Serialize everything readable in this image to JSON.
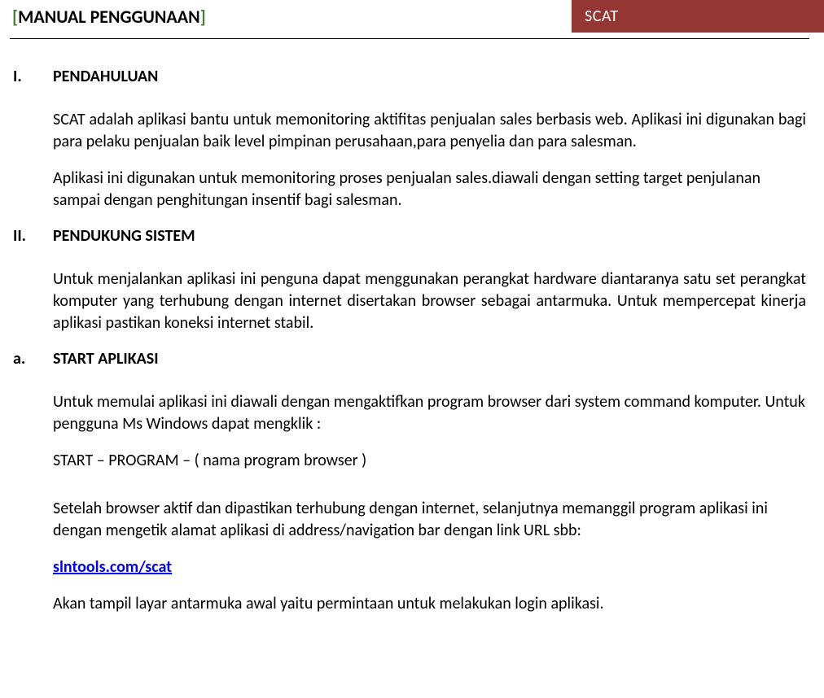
{
  "header": {
    "bracket_left": "[",
    "title": "MANUAL PENGGUNAAN",
    "bracket_right": "]",
    "badge": "SCAT"
  },
  "sections": {
    "s1": {
      "num": "I.",
      "heading": "PENDAHULUAN"
    },
    "s2": {
      "num": "II.",
      "heading": "PENDUKUNG SISTEM"
    },
    "s3": {
      "num": "a.",
      "heading": "START APLIKASI"
    }
  },
  "paragraphs": {
    "p1": "SCAT adalah aplikasi bantu untuk memonitoring aktifitas penjualan sales berbasis web. Aplikasi ini digunakan bagi para pelaku penjualan baik level pimpinan perusahaan,para penyelia dan para salesman.",
    "p2": "Aplikasi ini digunakan untuk memonitoring proses penjualan sales.diawali dengan setting target penjulanan sampai dengan penghitungan insentif bagi salesman.",
    "p3": "Untuk menjalankan aplikasi ini penguna dapat menggunakan perangkat hardware diantaranya satu set perangkat komputer yang terhubung dengan internet disertakan browser sebagai antarmuka. Untuk mempercepat kinerja aplikasi pastikan koneksi internet stabil.",
    "p4": "Untuk memulai aplikasi ini diawali dengan mengaktifkan program browser dari system command komputer. Untuk pengguna Ms Windows dapat mengklik :",
    "p5": "START – PROGRAM – ( nama program browser )",
    "p6": "Setelah browser aktif dan dipastikan terhubung dengan internet, selanjutnya memanggil program aplikasi ini dengan mengetik alamat aplikasi di address/navigation bar dengan link URL sbb:",
    "p7": "slntools.com/scat",
    "p8": "Akan tampil layar antarmuka awal yaitu permintaan untuk melakukan login aplikasi."
  }
}
